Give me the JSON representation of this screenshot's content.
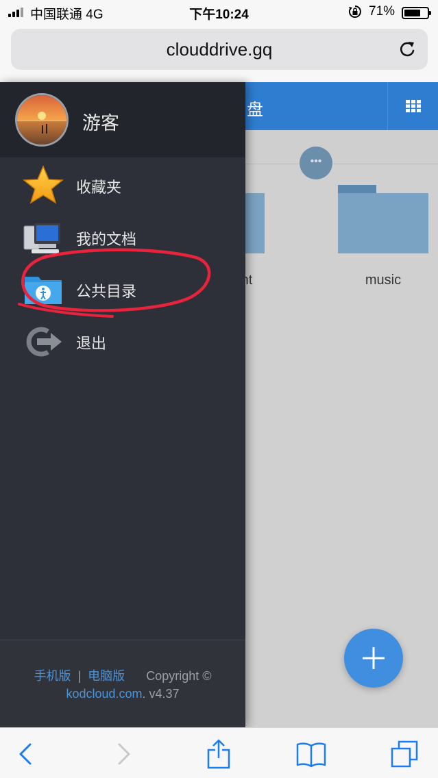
{
  "status_bar": {
    "carrier": "中国联通   4G",
    "time": "下午10:24",
    "battery_percent": "71%",
    "battery_level": 0.71
  },
  "browser": {
    "url": "clouddrive.gq"
  },
  "background_page": {
    "header_title": "盘",
    "folders": [
      {
        "name": "nt"
      },
      {
        "name": "music"
      }
    ]
  },
  "drawer": {
    "user_name": "游客",
    "menu": [
      {
        "label": "收藏夹",
        "icon": "star-icon"
      },
      {
        "label": "我的文档",
        "icon": "computer-icon"
      },
      {
        "label": "公共目录",
        "icon": "public-folder-icon"
      },
      {
        "label": "退出",
        "icon": "logout-icon"
      }
    ],
    "footer": {
      "mobile_link": "手机版",
      "separator": "|",
      "desktop_link": "电脑版",
      "copyright": "Copyright ©",
      "site_link": "kodcloud.com",
      "version": ". v4.37"
    }
  },
  "colors": {
    "accent_blue": "#2f7dd1",
    "drawer_bg": "#2d3038",
    "annotation_red": "#e8233c",
    "link_blue": "#4d93d9"
  }
}
